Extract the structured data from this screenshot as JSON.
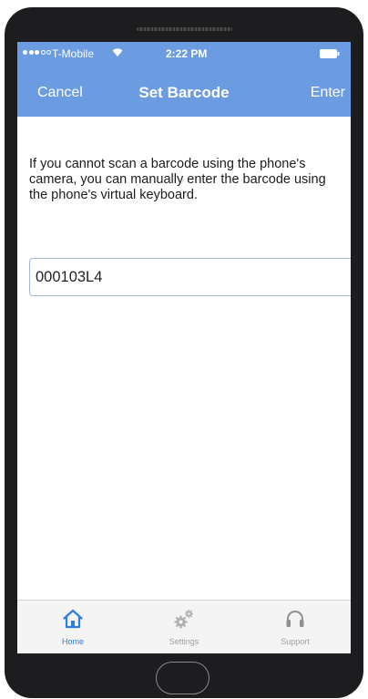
{
  "status_bar": {
    "carrier": "T-Mobile",
    "time": "2:22 PM"
  },
  "nav": {
    "cancel_label": "Cancel",
    "title": "Set Barcode",
    "enter_label": "Enter"
  },
  "content": {
    "instructions": "If you cannot scan a barcode using the phone's camera, you can manually enter the barcode using the phone's virtual keyboard.",
    "barcode_value": "000103L4"
  },
  "tabs": [
    {
      "label": "Home",
      "icon": "home-icon",
      "active": true
    },
    {
      "label": "Settings",
      "icon": "gears-icon",
      "active": false
    },
    {
      "label": "Support",
      "icon": "headphones-icon",
      "active": false
    }
  ],
  "colors": {
    "nav_background": "#6b9be0",
    "active_tab": "#2f7fe0",
    "inactive_tab": "#a0a0a0",
    "device_frame": "#1d1d1f"
  }
}
